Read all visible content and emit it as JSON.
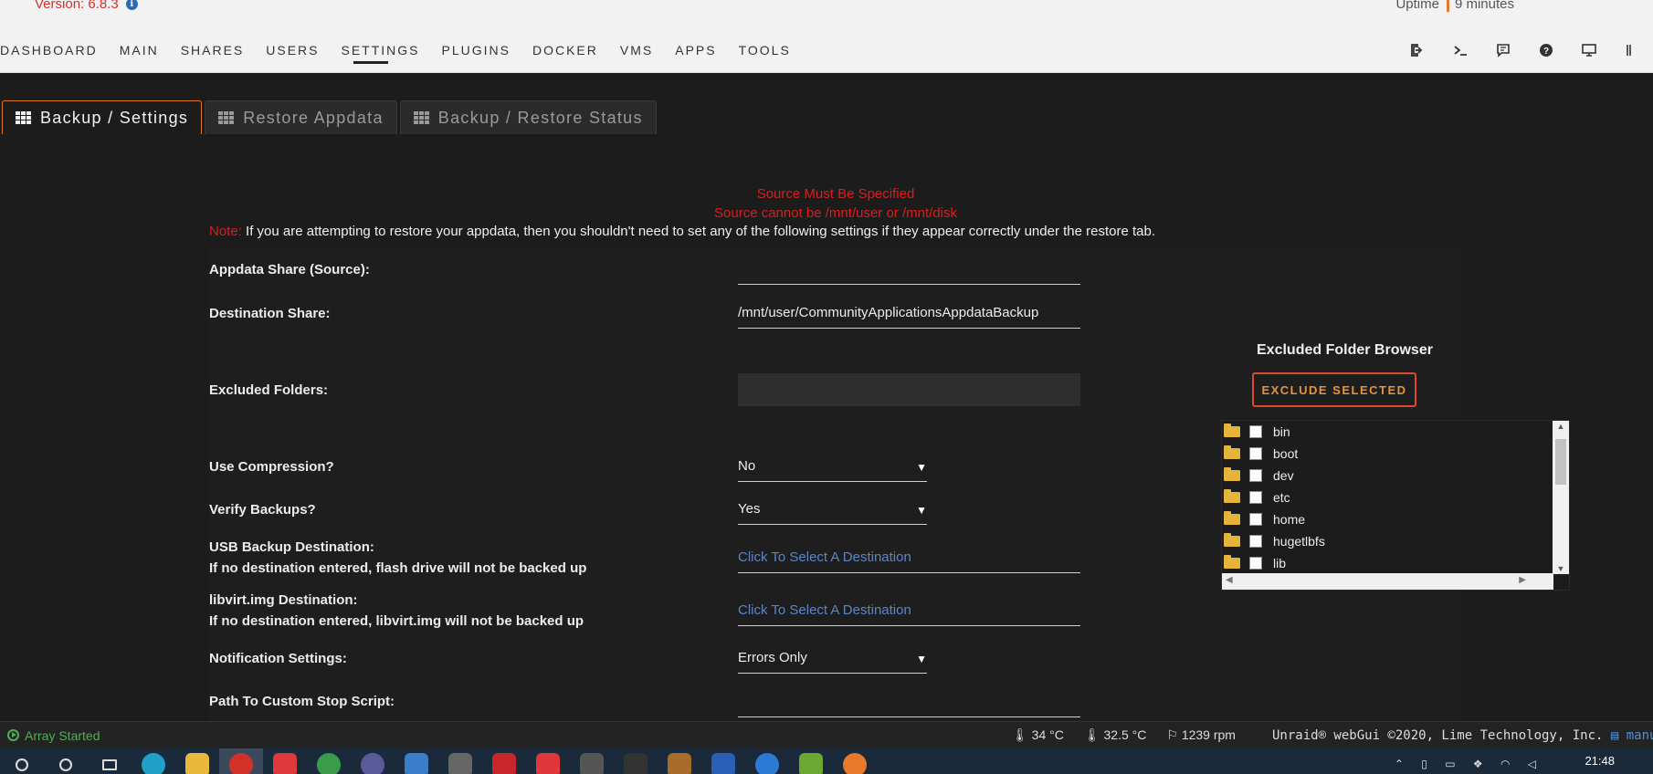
{
  "header": {
    "version": "Version: 6.8.3",
    "uptime_label": "Uptime",
    "uptime_value": "9 minutes"
  },
  "nav": {
    "items": [
      "DASHBOARD",
      "MAIN",
      "SHARES",
      "USERS",
      "SETTINGS",
      "PLUGINS",
      "DOCKER",
      "VMS",
      "APPS",
      "TOOLS"
    ],
    "active": "SETTINGS",
    "icons": [
      "logout-icon",
      "terminal-icon",
      "feedback-icon",
      "help-icon",
      "monitor-icon",
      "more-icon"
    ]
  },
  "tabs": [
    {
      "label": "Backup / Settings",
      "active": true
    },
    {
      "label": "Restore Appdata",
      "active": false
    },
    {
      "label": "Backup / Restore Status",
      "active": false
    }
  ],
  "errors": {
    "line1": "Source Must Be Specified",
    "line2": "Source cannot be /mnt/user or /mnt/disk"
  },
  "note": {
    "prefix": "Note:",
    "text": "If you are attempting to restore your appdata, then you shouldn't need to set any of the following settings if they appear correctly under the restore tab."
  },
  "settings": {
    "appdata_share": {
      "label": "Appdata Share (Source):",
      "value": ""
    },
    "destination_share": {
      "label": "Destination Share:",
      "value": "/mnt/user/CommunityApplicationsAppdataBackup"
    },
    "excluded_folders": {
      "label": "Excluded Folders:",
      "value": ""
    },
    "use_compression": {
      "label": "Use Compression?",
      "value": "No"
    },
    "verify_backups": {
      "label": "Verify Backups?",
      "value": "Yes"
    },
    "usb_backup": {
      "label": "USB Backup Destination:",
      "sub": "If no destination entered, flash drive will not be backed up",
      "placeholder": "Click To Select A Destination"
    },
    "libvirt": {
      "label": "libvirt.img Destination:",
      "sub": "If no destination entered, libvirt.img will not be backed up",
      "placeholder": "Click To Select A Destination"
    },
    "notification": {
      "label": "Notification Settings:",
      "value": "Errors Only"
    },
    "custom_stop_script": {
      "label": "Path To Custom Stop Script:",
      "value": ""
    }
  },
  "folder_browser": {
    "title": "Excluded Folder Browser",
    "button": "EXCLUDE SELECTED",
    "folders": [
      "bin",
      "boot",
      "dev",
      "etc",
      "home",
      "hugetlbfs",
      "lib"
    ]
  },
  "status": {
    "array": "Array Started",
    "temp1": "34 °C",
    "temp2": "32.5 °C",
    "fan": "1239 rpm",
    "copyright": "Unraid® webGui ©2020, Lime Technology, Inc.",
    "manual": "manual"
  },
  "taskbar": {
    "time": "21:48",
    "colors": {
      "accent": "#e07a2e",
      "error": "#d91e1e",
      "link": "#5a86c8",
      "ok": "#4caf50"
    }
  }
}
